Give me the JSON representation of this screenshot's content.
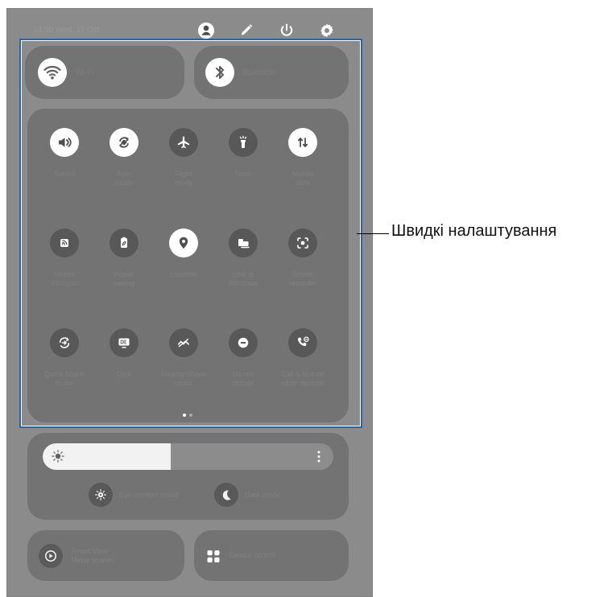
{
  "status_bar": {
    "text": "14:00 Wed, 11 Oct"
  },
  "quick_panel": {
    "wifi": {
      "label": "Wi-Fi"
    },
    "bluetooth": {
      "label": "Bluetooth"
    },
    "tiles": [
      {
        "label": "Sound",
        "icon": "sound-icon",
        "state": "on"
      },
      {
        "label": "Auto\nrotate",
        "icon": "auto-rotate-icon",
        "state": "on"
      },
      {
        "label": "Flight\nmode",
        "icon": "airplane-icon",
        "state": "off"
      },
      {
        "label": "Torch",
        "icon": "torch-icon",
        "state": "off"
      },
      {
        "label": "Mobile\ndata",
        "icon": "mobile-data-icon",
        "state": "on"
      },
      {
        "label": "Mobile\nHotspot",
        "icon": "hotspot-icon",
        "state": "off"
      },
      {
        "label": "Power\nsaving",
        "icon": "power-saving-icon",
        "state": "off"
      },
      {
        "label": "Location",
        "icon": "location-icon",
        "state": "on"
      },
      {
        "label": "Link to\nWindows",
        "icon": "link-to-windows-icon",
        "state": "off"
      },
      {
        "label": "Screen\nrecorder",
        "icon": "screen-recorder-icon",
        "state": "off"
      },
      {
        "label": "Quick Share\nto me",
        "icon": "quick-share-icon",
        "state": "off"
      },
      {
        "label": "DeX",
        "icon": "dex-icon",
        "state": "off"
      },
      {
        "label": "Nearby Share\nrouter",
        "icon": "nearby-share-icon",
        "state": "off"
      },
      {
        "label": "Do not\ndisturb",
        "icon": "do-not-disturb-icon",
        "state": "off"
      },
      {
        "label": "Call & text on\nother devices",
        "icon": "call-and-text-icon",
        "state": "off"
      }
    ],
    "page_indicator": {
      "current": 1,
      "total": 2
    }
  },
  "brightness": {
    "level_percent": 44,
    "modes": [
      {
        "label": "Eye comfort shield",
        "icon": "eye-comfort-shield-icon"
      },
      {
        "label": "Dark mode",
        "icon": "dark-mode-icon"
      }
    ]
  },
  "bottom_tiles": {
    "smart_view": {
      "title": "Smart View",
      "subtitle": "Mirror screen",
      "icon": "smart-view-icon"
    },
    "device_control": {
      "label": "Device control",
      "icon": "device-control-icon"
    }
  },
  "annotation": {
    "label": "Швидкі налаштування"
  },
  "colors": {
    "panel_background": "#8b8b8b",
    "tile_background": "#737373",
    "accent_frame": "#2a66a8",
    "icon_on": "#ffffff",
    "icon_off": "#585858"
  }
}
